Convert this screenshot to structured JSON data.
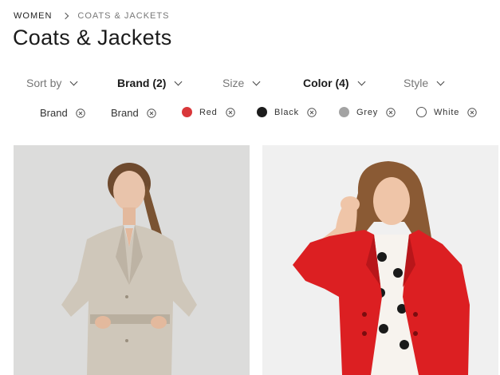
{
  "breadcrumb": {
    "root": "WOMEN",
    "current": "COATS & JACKETS"
  },
  "title": "Coats & Jackets",
  "filters": [
    {
      "label": "Sort by",
      "active": false
    },
    {
      "label": "Brand (2)",
      "active": true
    },
    {
      "label": "Size",
      "active": false
    },
    {
      "label": "Color (4)",
      "active": true
    },
    {
      "label": "Style",
      "active": false
    }
  ],
  "chips": [
    {
      "label": "Brand"
    },
    {
      "label": "Brand"
    },
    {
      "label": "Red",
      "color": "#d9373a"
    },
    {
      "label": "Black",
      "color": "#1c1c1c"
    },
    {
      "label": "Grey",
      "color": "#a3a3a3"
    },
    {
      "label": "White",
      "color": "#ffffff"
    }
  ],
  "icons": {
    "remove": "circle-x-icon",
    "chevron": "chevron-down-icon",
    "separator": "chevron-right-icon"
  },
  "products": [
    {
      "image": "woman-in-beige-linen-blazer"
    },
    {
      "image": "woman-in-red-blazer"
    }
  ]
}
